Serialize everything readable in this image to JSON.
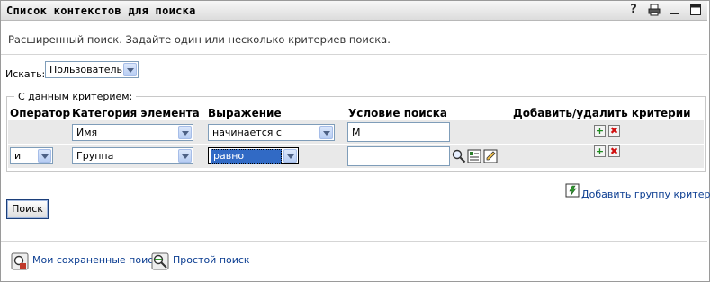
{
  "window": {
    "title": "Список контекстов для поиска",
    "icons": [
      "help-icon",
      "print-icon",
      "minimize-icon",
      "maximize-icon"
    ],
    "help_glyph": "?"
  },
  "description": "Расширенный поиск. Задайте один или несколько критериев поиска.",
  "search_for": {
    "label": "Искать:",
    "value": "Пользователь"
  },
  "criteria": {
    "legend": "С данным критерием:",
    "headers": {
      "operator": "Оператор",
      "category": "Категория элемента",
      "expression": "Выражение",
      "condition": "Условие поиска",
      "add_remove": "Добавить/удалить критерии"
    },
    "rows": [
      {
        "operator": "",
        "category": "Имя",
        "expression": "начинается с",
        "condition": "М"
      },
      {
        "operator": "и",
        "category": "Группа",
        "expression": "равно",
        "condition": ""
      }
    ],
    "plus_glyph": "+",
    "minus_glyph": "✖"
  },
  "add_group_label": "Добавить группу критериев",
  "search_button": "Поиск",
  "footer": {
    "saved_searches": "Мои сохраненные поиски",
    "simple_search": "Простой поиск"
  },
  "colors": {
    "highlight": "#316ac5",
    "link": "#0b3d91"
  }
}
